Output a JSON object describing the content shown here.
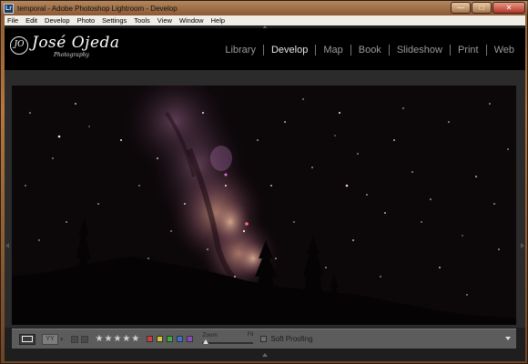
{
  "window": {
    "title": "temporal - Adobe Photoshop Lightroom - Develop",
    "app_icon_text": "Lr",
    "minimize_glyph": "—",
    "maximize_glyph": "□",
    "close_glyph": "✕"
  },
  "menubar": {
    "items": [
      "File",
      "Edit",
      "Develop",
      "Photo",
      "Settings",
      "Tools",
      "View",
      "Window",
      "Help"
    ]
  },
  "identity_plate": {
    "logo_mark": "JO",
    "name": "José Ojeda",
    "subtitle": "Photography"
  },
  "modules": {
    "items": [
      "Library",
      "Develop",
      "Map",
      "Book",
      "Slideshow",
      "Print",
      "Web"
    ],
    "active": "Develop"
  },
  "toolbar": {
    "compare_label": "YY",
    "caret": "▾",
    "stars": [
      "★",
      "★",
      "★",
      "★",
      "★"
    ],
    "color_labels": [
      "#d23a3a",
      "#d4c43a",
      "#3fae3f",
      "#3a72d2",
      "#8a4ac8"
    ],
    "zoom_label": "Zoom",
    "zoom_value": "Fit",
    "zoom_level": 0.0,
    "soft_proofing_label": "Soft Proofing",
    "soft_proofing_checked": false
  },
  "colors": {
    "app_background": "#2b2b2b",
    "identity_background": "#000000",
    "toolbar_background": "#5c5c5c",
    "module_active": "#e6e6e6",
    "module_inactive": "#9a9a9a"
  }
}
